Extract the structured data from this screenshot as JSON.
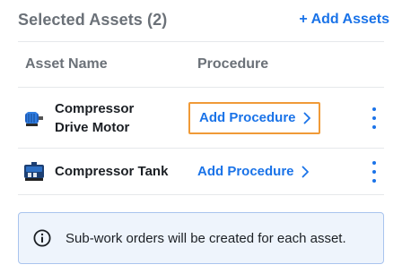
{
  "header": {
    "title": "Selected Assets (2)",
    "add_assets_label": "+ Add Assets"
  },
  "columns": {
    "asset_name": "Asset Name",
    "procedure": "Procedure"
  },
  "assets": [
    {
      "name_line1": "Compressor",
      "name_line2": "Drive Motor",
      "icon": "motor-icon",
      "procedure_label": "Add Procedure"
    },
    {
      "name": "Compressor Tank",
      "icon": "compressor-tank-icon",
      "procedure_label": "Add Procedure"
    }
  ],
  "info_banner": {
    "icon": "info-icon",
    "text": "Sub-work orders will be created for each asset."
  },
  "colors": {
    "accent": "#1a73e8",
    "focus_outline": "#f09a37",
    "banner_bg": "#eef4fc",
    "banner_border": "#a9c4ee"
  }
}
